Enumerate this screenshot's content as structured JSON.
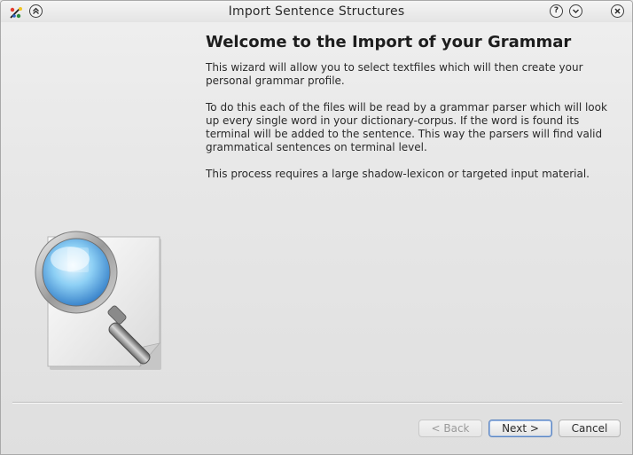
{
  "window": {
    "title": "Import Sentence Structures",
    "app_icon": "kde-app-icon",
    "titlebar_buttons": {
      "shade": "shade-up-icon",
      "help": "?",
      "minimize": "minimize-icon",
      "close": "close-icon"
    }
  },
  "page": {
    "heading": "Welcome to the Import of your Grammar",
    "paragraphs": [
      "This wizard will allow you to select textfiles which will then create your personal grammar profile.",
      "To do this each of the files will be read by a grammar parser which will look up every single word in your dictionary-corpus. If the word is found its terminal will be added to the sentence. This way the parsers will find valid grammatical sentences on terminal level.",
      "This process requires a large shadow-lexicon or targeted input material."
    ],
    "illustration": "magnifier-document-icon"
  },
  "buttons": {
    "back": "< Back",
    "next": "Next >",
    "cancel": "Cancel"
  },
  "colors": {
    "background": "#e6e6e6",
    "focus_border": "#5b84c0",
    "disabled_text": "#9a9a9a"
  }
}
